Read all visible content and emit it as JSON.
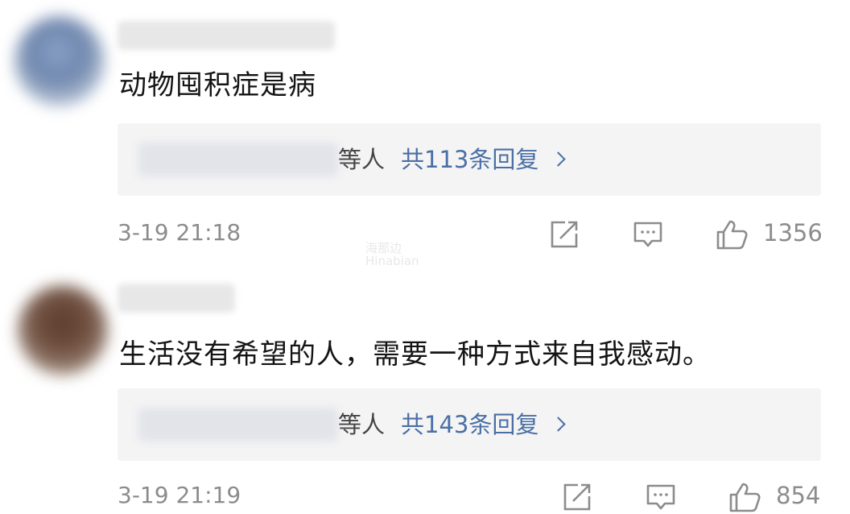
{
  "comments": [
    {
      "text": "动物囤积症是病",
      "reply_who": "等人",
      "reply_count": "共113条回复",
      "time": "3-19 21:18",
      "likes": "1356"
    },
    {
      "text": "生活没有希望的人，需要一种方式来自我感动。",
      "reply_who": "等人",
      "reply_count": "共143条回复",
      "time": "3-19 21:19",
      "likes": "854"
    }
  ],
  "watermark": {
    "line1": "海那边",
    "line2": "Hinabian"
  },
  "icons": {
    "share": "share-icon",
    "comment": "comment-icon",
    "like": "thumbs-up-icon",
    "reply_arrow": "chevron-right-icon"
  },
  "colors": {
    "link": "#4a6fa5",
    "meta": "#8c8c8c",
    "reply_bg": "#f4f4f4",
    "text": "#141414"
  }
}
